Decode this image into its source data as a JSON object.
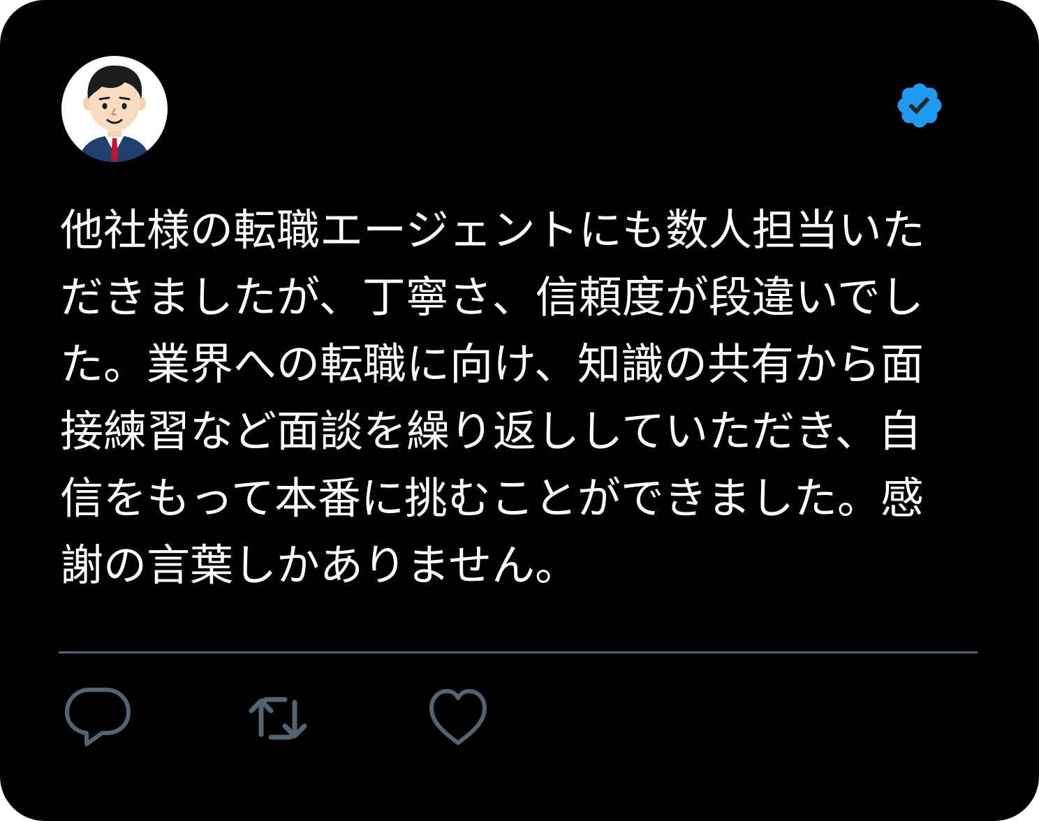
{
  "tweet": {
    "text": "他社様の転職エージェントにも数人担当いただきましたが、丁寧さ、信頼度が段違いでした。業界への転職に向け、知識の共有から面接練習など面談を繰り返ししていただき、自信をもって本番に挑むことができました。感謝の言葉しかありません。"
  },
  "author": {
    "avatar_icon": "businessman-avatar-icon",
    "verified_icon": "verified-badge-icon",
    "verified_color": "#1d9bf0"
  },
  "actions": [
    {
      "icon": "reply-icon"
    },
    {
      "icon": "retweet-icon"
    },
    {
      "icon": "like-icon"
    }
  ],
  "colors": {
    "background": "#000000",
    "text": "#ffffff",
    "icon": "#536471"
  }
}
